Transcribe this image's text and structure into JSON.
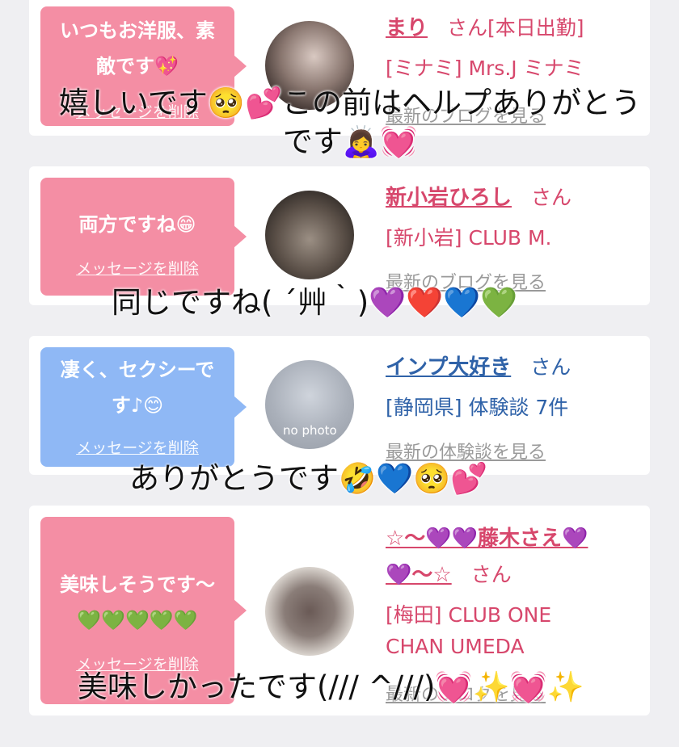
{
  "cards": [
    {
      "message": "いつもお洋服、素\n敵です💖",
      "delete_label": "メッセージを削除",
      "name": "まり",
      "san": "さん[本日出勤]",
      "line2": "[ミナミ] Mrs.J ミナミ",
      "link": "最新のブログを見る",
      "overlay": "嬉しいです🥺💕この前はヘルプありがとう\nです🙇‍♀️💓"
    },
    {
      "message": "両方ですね😁",
      "delete_label": "メッセージを削除",
      "name": "新小岩ひろし",
      "san": "さん",
      "line2": "[新小岩] CLUB M.",
      "link": "最新のブログを見る",
      "overlay": "同じですね( ´艸｀)💜❤️💙💚"
    },
    {
      "message": "凄く、セクシーで\nす♪😊",
      "delete_label": "メッセージを削除",
      "name": "インプ大好き",
      "san": "さん",
      "line2": "[静岡県] 体験談 7件",
      "link": "最新の体験談を見る",
      "avatar_label": "no photo",
      "overlay": "ありがとうです🤣💙🥺💕"
    },
    {
      "message": "美味しそうです〜\n💚💚💚💚💚",
      "delete_label": "メッセージを削除",
      "name_line1": "☆〜💜💜藤木さえ💜",
      "name_line2": "💜〜☆",
      "san": "さん",
      "line2a": "[梅田] CLUB ONE",
      "line2b": "CHAN UMEDA",
      "link": "最新のブログを見る",
      "overlay": "美味しかったです(/// ^///)💓✨💓✨"
    }
  ],
  "colors": {
    "pink_bubble": "#f48ea4",
    "blue_bubble": "#8fb8f5",
    "pink_text": "#d7476c",
    "blue_text": "#2f62a8"
  }
}
